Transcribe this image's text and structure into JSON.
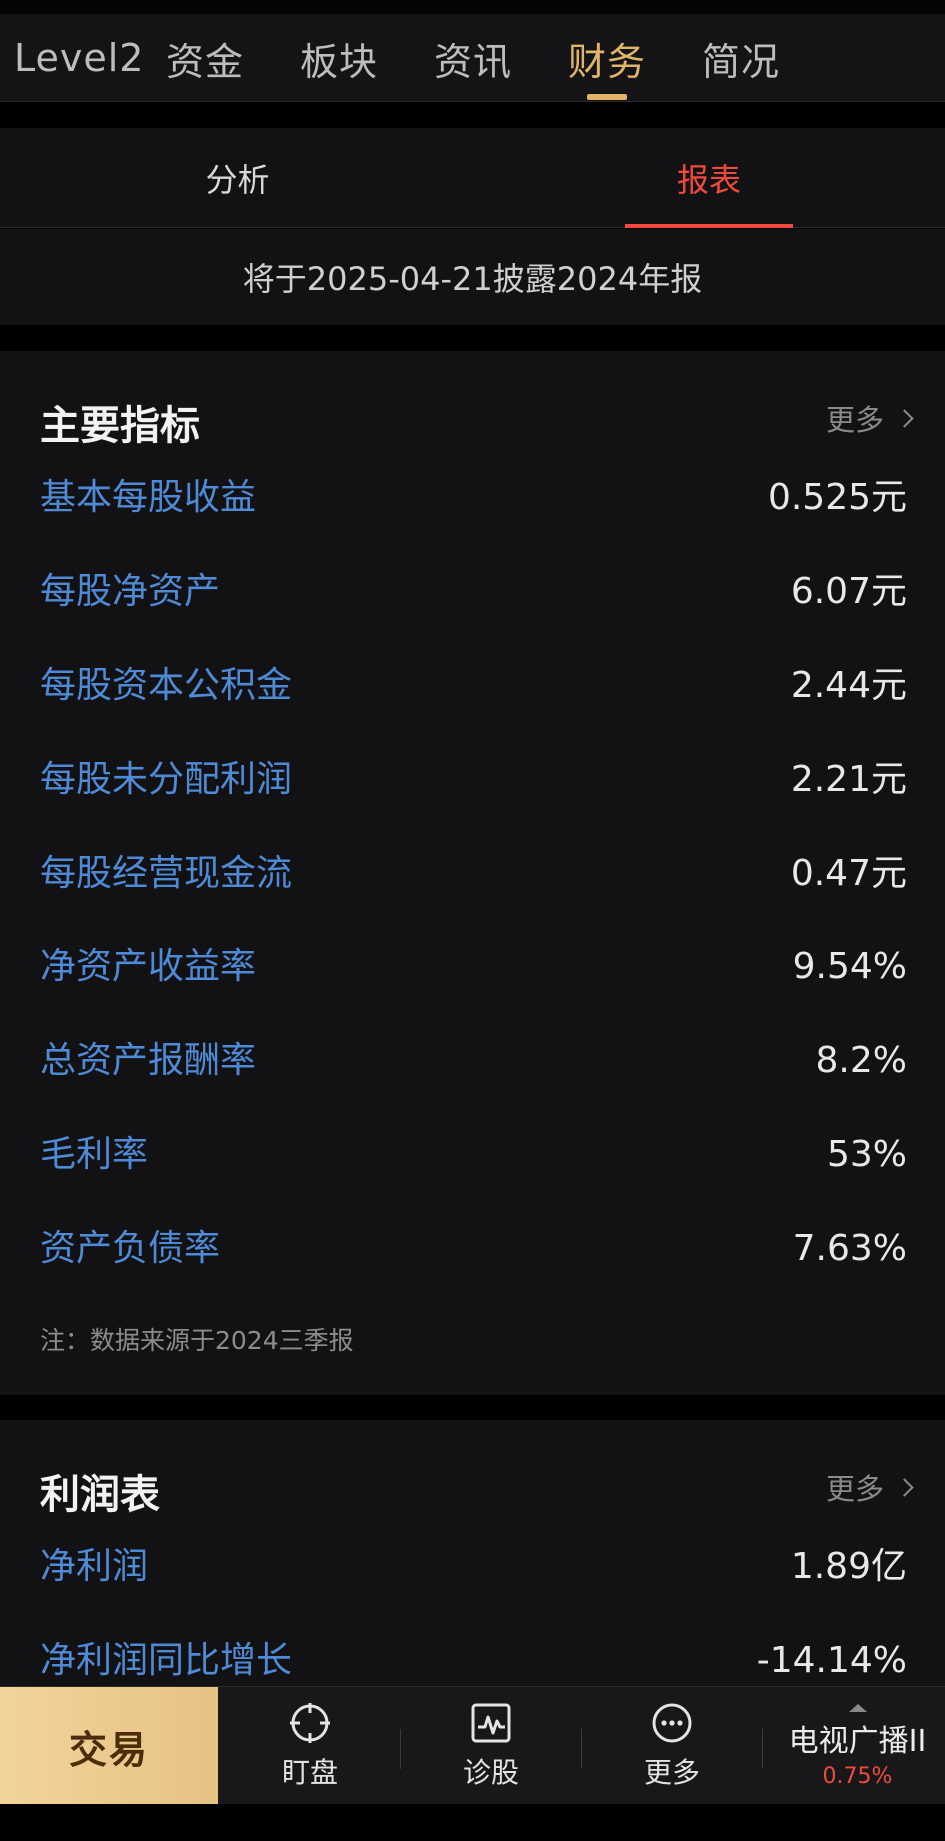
{
  "top_tabs": [
    {
      "label": "Level2"
    },
    {
      "label": "资金"
    },
    {
      "label": "板块"
    },
    {
      "label": "资讯"
    },
    {
      "label": "财务",
      "active": true
    },
    {
      "label": "简况"
    }
  ],
  "sub_tabs": [
    {
      "label": "分析"
    },
    {
      "label": "报表",
      "active": true
    }
  ],
  "notice": "将于2025-04-21披露2024年报",
  "main_indicators": {
    "title": "主要指标",
    "more": "更多",
    "rows": [
      {
        "label": "基本每股收益",
        "value": "0.525元"
      },
      {
        "label": "每股净资产",
        "value": "6.07元"
      },
      {
        "label": "每股资本公积金",
        "value": "2.44元"
      },
      {
        "label": "每股未分配利润",
        "value": "2.21元"
      },
      {
        "label": "每股经营现金流",
        "value": "0.47元"
      },
      {
        "label": "净资产收益率",
        "value": "9.54%"
      },
      {
        "label": "总资产报酬率",
        "value": "8.2%"
      },
      {
        "label": "毛利率",
        "value": "53%"
      },
      {
        "label": "资产负债率",
        "value": "7.63%"
      }
    ],
    "note": "注：数据来源于2024三季报"
  },
  "income_statement": {
    "title": "利润表",
    "more": "更多",
    "rows": [
      {
        "label": "净利润",
        "value": "1.89亿"
      },
      {
        "label": "净利润同比增长",
        "value": "-14.14%"
      }
    ]
  },
  "bottom_nav": {
    "trade": "交易",
    "items": [
      {
        "label": "盯盘",
        "icon": "target-icon"
      },
      {
        "label": "诊股",
        "icon": "pulse-chart-icon"
      },
      {
        "label": "更多",
        "icon": "more-dots-icon"
      }
    ],
    "stock": {
      "name": "电视广播II",
      "change": "0.75%"
    }
  },
  "colors": {
    "accent_gold": "#e2b46a",
    "accent_red": "#f04a3c",
    "label_blue": "#4f8ad6",
    "background": "#121214"
  }
}
